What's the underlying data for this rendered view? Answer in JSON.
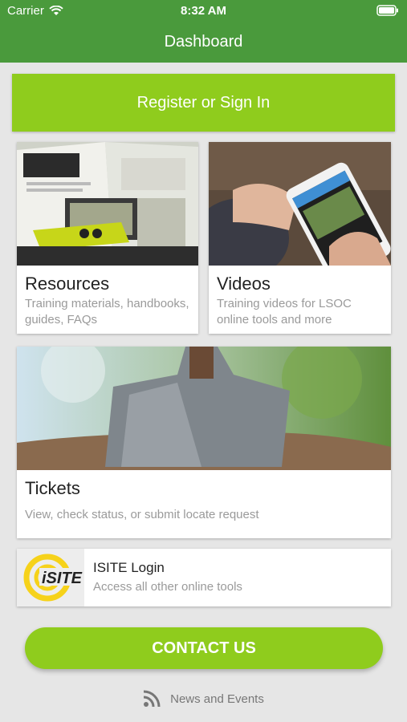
{
  "status_bar": {
    "carrier": "Carrier",
    "time": "8:32 AM"
  },
  "nav": {
    "title": "Dashboard"
  },
  "register_button": "Register or Sign In",
  "cards": {
    "resources": {
      "title": "Resources",
      "description": "Training materials, handbooks, guides, FAQs"
    },
    "videos": {
      "title": "Videos",
      "description": "Training videos for LSOC online tools and more"
    },
    "tickets": {
      "title": "Tickets",
      "description": "View, check status, or submit locate request"
    },
    "isite": {
      "title": "ISITE Login",
      "description": "Access all other online tools",
      "logo_text": "iSITE"
    }
  },
  "contact_button": "CONTACT US",
  "news_link": "News and Events",
  "colors": {
    "header_green": "#4a9a3c",
    "accent_green": "#8fcc1d",
    "logo_yellow": "#f6d21a"
  }
}
